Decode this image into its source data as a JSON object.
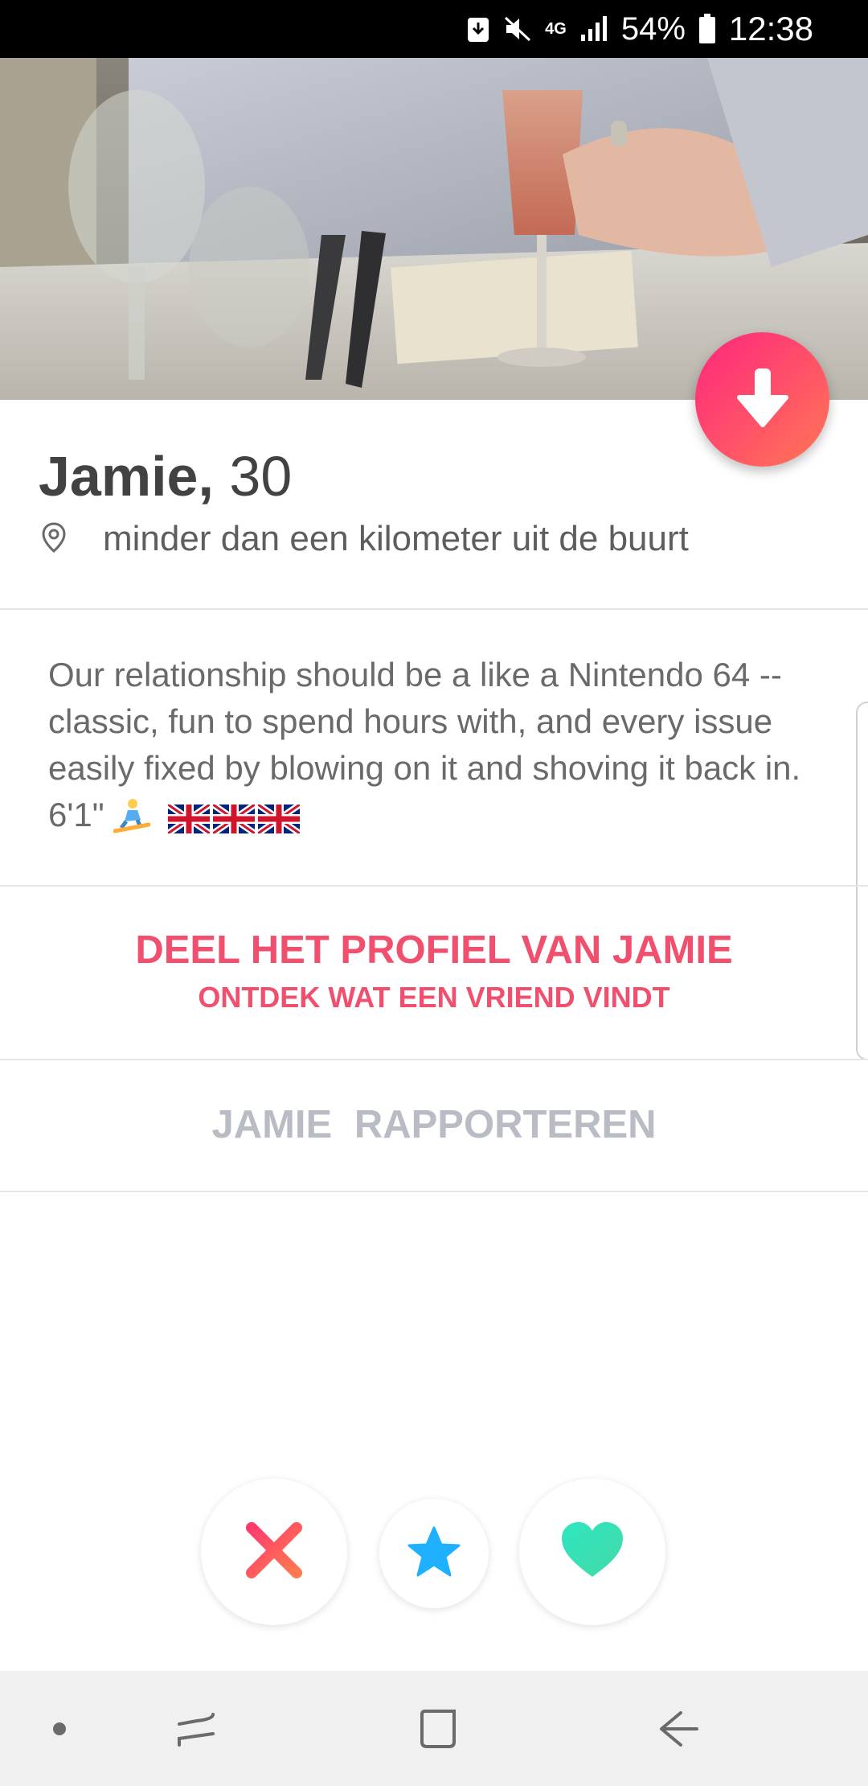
{
  "status_bar": {
    "network": "4G",
    "battery": "54%",
    "time": "12:38",
    "icons": [
      "download-icon",
      "mute-icon",
      "signal-icon",
      "battery-icon"
    ]
  },
  "profile": {
    "name": "Jamie,",
    "age": "30",
    "location": "minder dan een kilometer uit de buurt",
    "location_icon": "map-pin-icon",
    "bio_text": "Our relationship should be a like a Nintendo 64 -- classic, fun to spend hours with, and every issue easily fixed by blowing on it and shoving it back in. 6'1\"",
    "bio_emoji": [
      "snowboarder-emoji",
      "uk-flag-emoji",
      "uk-flag-emoji",
      "uk-flag-emoji"
    ]
  },
  "share": {
    "title": "DEEL HET PROFIEL VAN JAMIE",
    "subtitle": "ONTDEK WAT EEN VRIEND VINDT"
  },
  "report": {
    "label": "JAMIE  RAPPORTEREN"
  },
  "actions": {
    "nope_icon": "x-icon",
    "superlike_icon": "star-icon",
    "like_icon": "heart-icon",
    "colors": {
      "nope": "#ff4f5a",
      "superlike": "#1fb0ff",
      "like": "#3ae0b4",
      "brand": "#fd297b"
    }
  },
  "nav_bar": {
    "items": [
      "dot-icon",
      "recent-apps-icon",
      "home-icon",
      "back-icon"
    ]
  }
}
